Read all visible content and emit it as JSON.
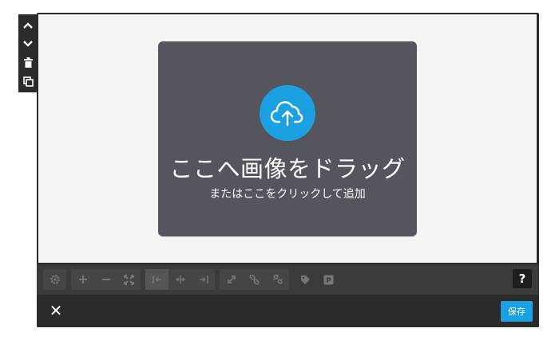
{
  "side_toolbar": {
    "items": [
      {
        "icon": "chevron-up-icon"
      },
      {
        "icon": "chevron-down-icon"
      },
      {
        "icon": "trash-icon"
      },
      {
        "icon": "duplicate-icon"
      }
    ]
  },
  "dropzone": {
    "icon": "cloud-upload-icon",
    "title": "ここへ画像をドラッグ",
    "subtitle": "またはここをクリックして追加"
  },
  "edit_toolbar": {
    "groups": [
      [
        "settings-icon"
      ],
      [
        "zoom-in-icon",
        "zoom-out-icon",
        "fit-icon"
      ],
      [
        "align-left-icon",
        "align-center-icon",
        "align-right-icon"
      ],
      [
        "fullsize-icon",
        "link-icon",
        "unlink-icon"
      ],
      [
        "tag-icon",
        "pinterest-icon"
      ]
    ],
    "help_label": "?"
  },
  "action_bar": {
    "close_label": "✕",
    "save_label": "保存"
  },
  "colors": {
    "accent": "#1ba1e2",
    "dropzone_bg": "#55565d",
    "frame_bg": "#2a2a2a",
    "toolbar_bg": "#3b3b3b"
  }
}
